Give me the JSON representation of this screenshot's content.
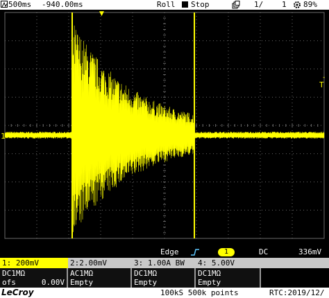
{
  "top_bar": {
    "timebase": "500ms",
    "delay": "-940.00ms",
    "mode": "Roll",
    "run_state": "Stop",
    "trigger_count": "1/",
    "acq_count": "1",
    "battery": "89%",
    "run_icon": "square-icon",
    "gear_icon": "gear-icon",
    "mem_icon": "stack-icon"
  },
  "markers": {
    "channel1_ground": "1",
    "trigger_level": "T",
    "trigger_time": "▼"
  },
  "status": {
    "trigger_type": "Edge",
    "slope_icon": "rising-edge-icon",
    "trigger_source": "1",
    "trigger_coupling": "DC",
    "trigger_level": "336mV"
  },
  "channels": [
    {
      "label": "1: 200mV",
      "coupling": "DC1MΩ",
      "extra_label": "ofs",
      "extra_value": "0.00V"
    },
    {
      "label": "2:2.00mV",
      "coupling": "AC1MΩ",
      "extra_label": "Empty",
      "extra_value": ""
    },
    {
      "label": "3: 1.00A  BW",
      "coupling": "DC1MΩ",
      "extra_label": "Empty",
      "extra_value": ""
    },
    {
      "label": "4: 5.00V",
      "coupling": "DC1MΩ",
      "extra_label": "Empty",
      "extra_value": ""
    }
  ],
  "footer": {
    "brand": "LeCroy",
    "sample_rate": "100kS 500k points",
    "rtc": "RTC:2019/12/"
  },
  "colors": {
    "trace": "#ffff00",
    "grid": "#6a6a6a",
    "background": "#000000",
    "cursor": "#ffff00"
  },
  "chart_data": {
    "type": "line",
    "series": [
      {
        "name": "1",
        "values": []
      }
    ],
    "x_divisions": 10,
    "y_divisions": 8,
    "grid": true
  }
}
